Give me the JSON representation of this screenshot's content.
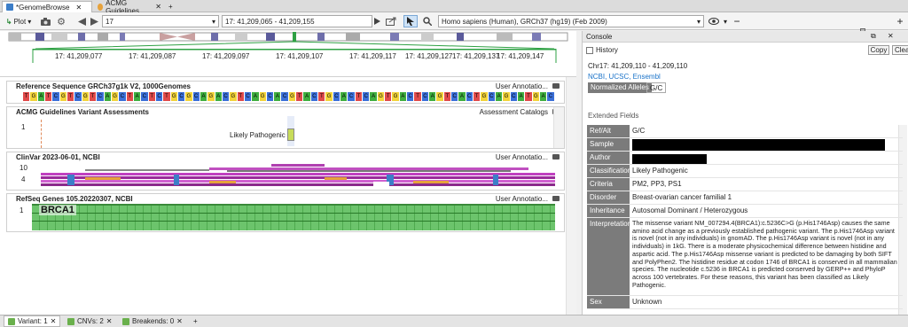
{
  "tabs": [
    {
      "label": "*GenomeBrowse",
      "icon": "genome-icon",
      "active": true
    },
    {
      "label": "ACMG Guidelines",
      "icon": "acmg-icon",
      "active": false
    }
  ],
  "toolbar": {
    "plot_label": "Plot",
    "chromosome": "17",
    "locus": "17: 41,209,065 - 41,209,155",
    "assembly": "Homo sapiens (Human), GRCh37 (hg19) (Feb 2009)"
  },
  "ruler_ticks": [
    "17: 41,209,077",
    "17: 41,209,087",
    "17: 41,209,097",
    "17: 41,209,107",
    "17: 41,209,117",
    "17: 41,209,127",
    "17: 41,209,137",
    "17: 41,209,147"
  ],
  "tracks": {
    "reference": {
      "title": "Reference Sequence GRCh37g1k V2, 1000Genomes",
      "right": "User Annotatio...",
      "sequence": "TGATCGTCGTCAGCTACTCTGCGCAGACGTCAGCACGTACTGCACTCAGTGACTCAGTCACTGCAGCATGAC"
    },
    "acmg": {
      "title": "ACMG Guidelines Variant Assessments",
      "right": "Assessment Catalogs",
      "axis": "1",
      "label": "Likely Pathogenic"
    },
    "clinvar": {
      "title": "ClinVar 2023-06-01, NCBI",
      "right": "User Annotatio...",
      "axis_top": "10",
      "axis_bottom": "4"
    },
    "refseq": {
      "title": "RefSeq Genes 105.20220307, NCBI",
      "right": "User Annotatio...",
      "gene": "BRCA1",
      "axis": "1"
    }
  },
  "console": {
    "title": "Console",
    "history": "History",
    "copy": "Copy",
    "clear": "Clea",
    "coord": "Chr17: 41,209,110 - 41,209,110",
    "links": "NCBI, UCSC, Ensembl",
    "normalized_label": "Normalized Alleles",
    "normalized_value": "G/C",
    "extended_fields": "Extended Fields",
    "fields": [
      {
        "key": "Ref/Alt",
        "value": "G/C"
      },
      {
        "key": "Sample",
        "value": ""
      },
      {
        "key": "Author",
        "value": ""
      },
      {
        "key": "Classification",
        "value": "Likely Pathogenic"
      },
      {
        "key": "Criteria",
        "value": "PM2, PP3, PS1"
      },
      {
        "key": "Disorder",
        "value": "Breast-ovarian cancer familial 1"
      },
      {
        "key": "Inheritance",
        "value": "Autosomal Dominant / Heterozygous"
      },
      {
        "key": "Interpretation",
        "value": "The missense variant NM_007294.4(BRCA1):c.5236C>G (p.His1746Asp) causes the same amino acid change as a previously established pathogenic variant. The p.His1746Asp variant is novel (not in any individuals) in gnomAD. The p.His1746Asp variant is novel (not in any individuals) in 1kG. There is a moderate physicochemical difference between histidine and aspartic acid. The p.His1746Asp missense variant is predicted to be damaging by both SIFT and PolyPhen2. The histidine residue at codon 1746 of BRCA1 is conserved in all mammalian species. The nucleotide c.5236 in BRCA1 is predicted conserved by GERP++ and PhyloP across 100 vertebrates. For these reasons, this variant has been classified as Likely Pathogenic."
      },
      {
        "key": "Sex",
        "value": "Unknown"
      }
    ]
  },
  "bottom_tabs": [
    {
      "label": "Variant: 1"
    },
    {
      "label": "CNVs: 2"
    },
    {
      "label": "Breakends: 0"
    }
  ],
  "colors": {
    "A": "#3fae3f",
    "C": "#3a6fd8",
    "G": "#f2d33a",
    "T": "#e04a4a",
    "accent": "#1a73c9"
  }
}
